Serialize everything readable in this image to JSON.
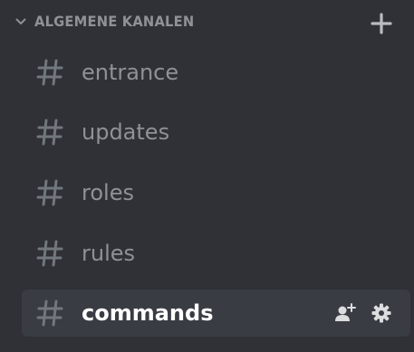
{
  "category": {
    "label": "ALGEMENE KANALEN",
    "chevron_icon": "chevron-down-icon",
    "add_icon": "plus-icon"
  },
  "channels": [
    {
      "name": "entrance",
      "icon": "hash-icon",
      "selected": false
    },
    {
      "name": "updates",
      "icon": "hash-icon",
      "selected": false
    },
    {
      "name": "roles",
      "icon": "hash-icon",
      "selected": false
    },
    {
      "name": "rules",
      "icon": "hash-icon",
      "selected": false
    },
    {
      "name": "commands",
      "icon": "hash-icon",
      "selected": true
    }
  ],
  "selected_channel_actions": [
    "invite-user-icon",
    "gear-icon"
  ],
  "colors": {
    "background": "#2f3136",
    "selected_background": "#393c43",
    "muted_text": "#8e9297",
    "active_text": "#ffffff",
    "icon": "#72767d"
  }
}
